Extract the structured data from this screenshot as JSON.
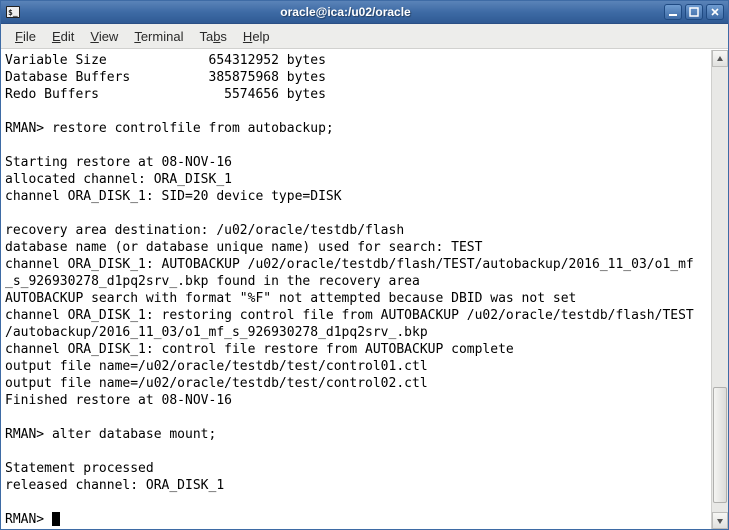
{
  "window": {
    "title": "oracle@ica:/u02/oracle"
  },
  "menubar": {
    "file": "File",
    "edit": "Edit",
    "view": "View",
    "terminal": "Terminal",
    "tabs": "Tabs",
    "help": "Help"
  },
  "terminal": {
    "lines": [
      "Variable Size             654312952 bytes",
      "Database Buffers          385875968 bytes",
      "Redo Buffers                5574656 bytes",
      "",
      "RMAN> restore controlfile from autobackup;",
      "",
      "Starting restore at 08-NOV-16",
      "allocated channel: ORA_DISK_1",
      "channel ORA_DISK_1: SID=20 device type=DISK",
      "",
      "recovery area destination: /u02/oracle/testdb/flash",
      "database name (or database unique name) used for search: TEST",
      "channel ORA_DISK_1: AUTOBACKUP /u02/oracle/testdb/flash/TEST/autobackup/2016_11_03/o1_mf",
      "_s_926930278_d1pq2srv_.bkp found in the recovery area",
      "AUTOBACKUP search with format \"%F\" not attempted because DBID was not set",
      "channel ORA_DISK_1: restoring control file from AUTOBACKUP /u02/oracle/testdb/flash/TEST",
      "/autobackup/2016_11_03/o1_mf_s_926930278_d1pq2srv_.bkp",
      "channel ORA_DISK_1: control file restore from AUTOBACKUP complete",
      "output file name=/u02/oracle/testdb/test/control01.ctl",
      "output file name=/u02/oracle/testdb/test/control02.ctl",
      "Finished restore at 08-NOV-16",
      "",
      "RMAN> alter database mount;",
      "",
      "Statement processed",
      "released channel: ORA_DISK_1",
      "",
      "RMAN> "
    ]
  }
}
